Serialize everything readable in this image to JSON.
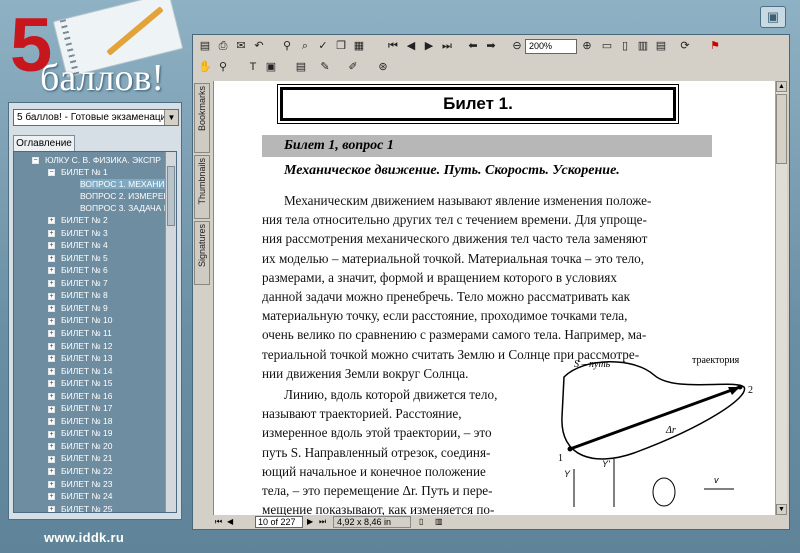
{
  "app": {
    "logo_number": "5",
    "logo_word": "баллов!",
    "website": "www.iddk.ru"
  },
  "left_panel": {
    "book_select": "5 баллов! - Готовые экзаменацион",
    "tab_label": "Оглавление",
    "tree": {
      "root": "ЮЛКУ С. В. ФИЗИКА. ЭКСПР",
      "ticket1": "БИЛЕТ № 1",
      "questions": [
        "ВОПРОС 1. МЕХАНИЧ",
        "ВОПРОС 2. ИЗМЕРЕН",
        "ВОПРОС 3. ЗАДАЧА Н"
      ],
      "tickets": [
        "БИЛЕТ № 2",
        "БИЛЕТ № 3",
        "БИЛЕТ № 4",
        "БИЛЕТ № 5",
        "БИЛЕТ № 6",
        "БИЛЕТ № 7",
        "БИЛЕТ № 8",
        "БИЛЕТ № 9",
        "БИЛЕТ № 10",
        "БИЛЕТ № 11",
        "БИЛЕТ № 12",
        "БИЛЕТ № 13",
        "БИЛЕТ № 14",
        "БИЛЕТ № 15",
        "БИЛЕТ № 16",
        "БИЛЕТ № 17",
        "БИЛЕТ № 18",
        "БИЛЕТ № 19",
        "БИЛЕТ № 20",
        "БИЛЕТ № 21",
        "БИЛЕТ № 22",
        "БИЛЕТ № 23",
        "БИЛЕТ № 24",
        "БИЛЕТ № 25"
      ]
    }
  },
  "viewer": {
    "zoom": "200%",
    "side_tabs": [
      "Bookmarks",
      "Thumbnails",
      "Signatures"
    ],
    "page_indicator": "10 of 227",
    "page_size": "4,92 x 8,46 in"
  },
  "document": {
    "title": "Билет 1.",
    "question_header": "Билет 1, вопрос 1",
    "section_title": "Механическое движение. Путь. Скорость. Ускорение.",
    "lines": [
      "Механическим движением называют явление изменения положе-",
      "ния тела относительно других тел с течением времени. Для упроще-",
      "ния рассмотрения механического движения тел часто тела заменяют",
      "их моделью – материальной точкой. Материальная точка – это тело,",
      "размерами, а значит, формой  и вращением которого в условиях",
      "данной задачи можно пренебречь. Тело можно рассматривать как",
      "материальную точку, если расстояние, проходимое точками тела,",
      "очень велико по сравнению с размерами самого тела. Например, ма-",
      "териальной точкой можно считать  Землю и Солнце при рассмотре-",
      "нии движения Земли вокруг Солнца."
    ],
    "col_lines": [
      "Линию, вдоль которой движется тело,",
      "называют траекторией. Расстояние,",
      "измеренное вдоль этой траектории, – это",
      "путь S. Направленный отрезок, соединя-",
      "ющий начальное и конечное положение",
      "тела, – это перемещение Δr.  Путь и пере-",
      "мещение показывают, как изменяется по-"
    ],
    "figure": {
      "path_label": "S – путь",
      "trajectory_label": "траектория",
      "point1": "1",
      "point2": "2",
      "dr_label": "Δr",
      "y_label": "Y",
      "y2_label": "Y'",
      "v_label": "v"
    }
  }
}
